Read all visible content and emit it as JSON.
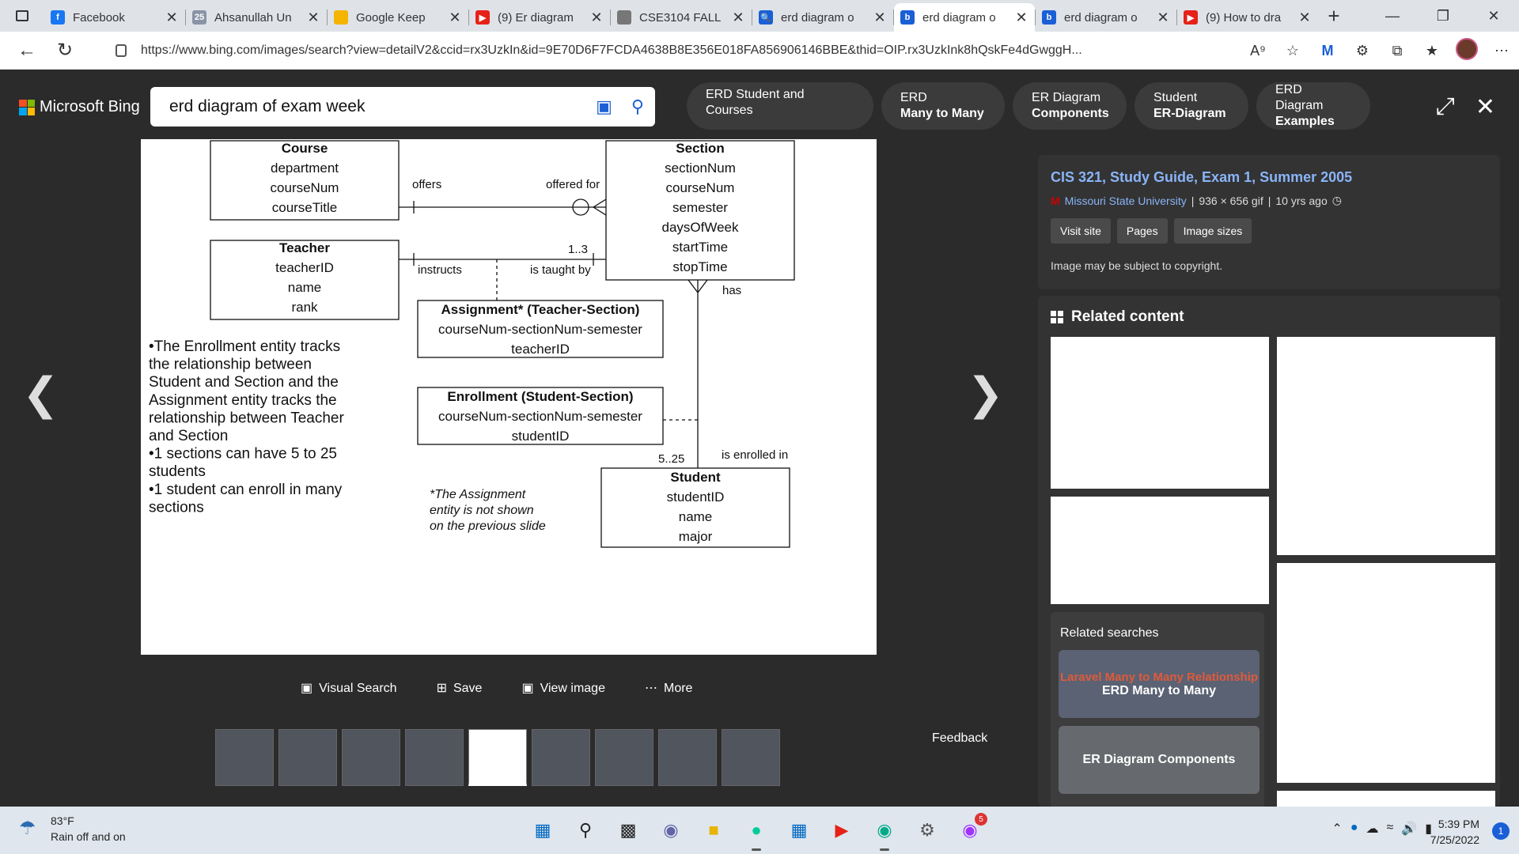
{
  "tabs": [
    {
      "label": "Facebook",
      "fav_color": "#1877f2",
      "fav_glyph": "f",
      "active": false
    },
    {
      "label": "Ahsanullah Un",
      "fav_color": "#8a94a6",
      "fav_glyph": "25",
      "active": false
    },
    {
      "label": "Google Keep",
      "fav_color": "#f4b400",
      "fav_glyph": "",
      "active": false
    },
    {
      "label": "(9) Er diagram",
      "fav_color": "#e62117",
      "fav_glyph": "▶",
      "active": false
    },
    {
      "label": "CSE3104 FALL",
      "fav_color": "#777777",
      "fav_glyph": "",
      "active": false
    },
    {
      "label": "erd diagram o",
      "fav_color": "#1a5fd6",
      "fav_glyph": "🔍",
      "active": false
    },
    {
      "label": "erd diagram o",
      "fav_color": "#1a5fd6",
      "fav_glyph": "b",
      "active": true
    },
    {
      "label": "erd diagram o",
      "fav_color": "#1a5fd6",
      "fav_glyph": "b",
      "active": false
    },
    {
      "label": "(9) How to dra",
      "fav_color": "#e62117",
      "fav_glyph": "▶",
      "active": false
    }
  ],
  "address": {
    "url": "https://www.bing.com/images/search?view=detailV2&ccid=rx3UzkIn&id=9E70D6F7FCDA4638B8E356E018FA856906146BBE&thid=OIP.rx3UzkInk8hQskFe4dGwggH..."
  },
  "bing": {
    "brand": "Microsoft Bing",
    "query": "erd diagram of exam week",
    "chips": [
      {
        "line1": "ERD Student and Courses",
        "line2": ""
      },
      {
        "line1": "ERD",
        "line2": "Many to Many"
      },
      {
        "line1": "ER Diagram",
        "line2": "Components"
      },
      {
        "line1": "Student",
        "line2": "ER-Diagram"
      },
      {
        "line1": "ERD Diagram",
        "line2": "Examples"
      }
    ]
  },
  "diagram": {
    "course": {
      "title": "Course",
      "attrs": [
        "department",
        "courseNum",
        "courseTitle"
      ]
    },
    "section": {
      "title": "Section",
      "attrs": [
        "sectionNum",
        "courseNum",
        "semester",
        "daysOfWeek",
        "startTime",
        "stopTime"
      ]
    },
    "teacher": {
      "title": "Teacher",
      "attrs": [
        "teacherID",
        "name",
        "rank"
      ]
    },
    "assignment": {
      "title": "Assignment* (Teacher-Section)",
      "attrs": [
        "courseNum-sectionNum-semester",
        "teacherID"
      ]
    },
    "enrollment": {
      "title": "Enrollment (Student-Section)",
      "attrs": [
        "courseNum-sectionNum-semester",
        "studentID"
      ]
    },
    "student": {
      "title": "Student",
      "attrs": [
        "studentID",
        "name",
        "major"
      ]
    },
    "labels": {
      "offers": "offers",
      "offered_for": "offered for",
      "instructs": "instructs",
      "one_three": "1..3",
      "is_taught_by": "is taught by",
      "has": "has",
      "five_25": "5..25",
      "is_enrolled_in": "is enrolled in"
    },
    "notes": [
      "•The Enrollment entity tracks",
      "the relationship between",
      "Student and Section and the",
      "Assignment entity tracks the",
      "relationship between Teacher",
      "and Section",
      "•1 sections can have 5 to 25",
      "students",
      "•1 student can enroll in many",
      "sections"
    ],
    "footnote": [
      "*The Assignment",
      "entity is not shown",
      "on the previous slide"
    ]
  },
  "actions": [
    "Visual Search",
    "Save",
    "View image",
    "More"
  ],
  "feedback": "Feedback",
  "info": {
    "title": "CIS 321, Study Guide, Exam 1, Summer 2005",
    "source": "Missouri State University",
    "size": "936 × 656 gif",
    "age": "10 yrs ago",
    "buttons": [
      "Visit site",
      "Pages",
      "Image sizes"
    ],
    "note": "Image may be subject to copyright."
  },
  "related": {
    "title": "Related content",
    "searches_title": "Related searches",
    "searches": [
      {
        "label": "ERD Many to Many",
        "overlay": "Laravel Many to Many Relationship"
      },
      {
        "label": "ER Diagram Components",
        "overlay": ""
      }
    ]
  },
  "taskbar": {
    "temp": "83°F",
    "weather": "Rain off and on",
    "time": "5:39 PM",
    "date": "7/25/2022",
    "notif_count": "1",
    "badge": "5"
  }
}
